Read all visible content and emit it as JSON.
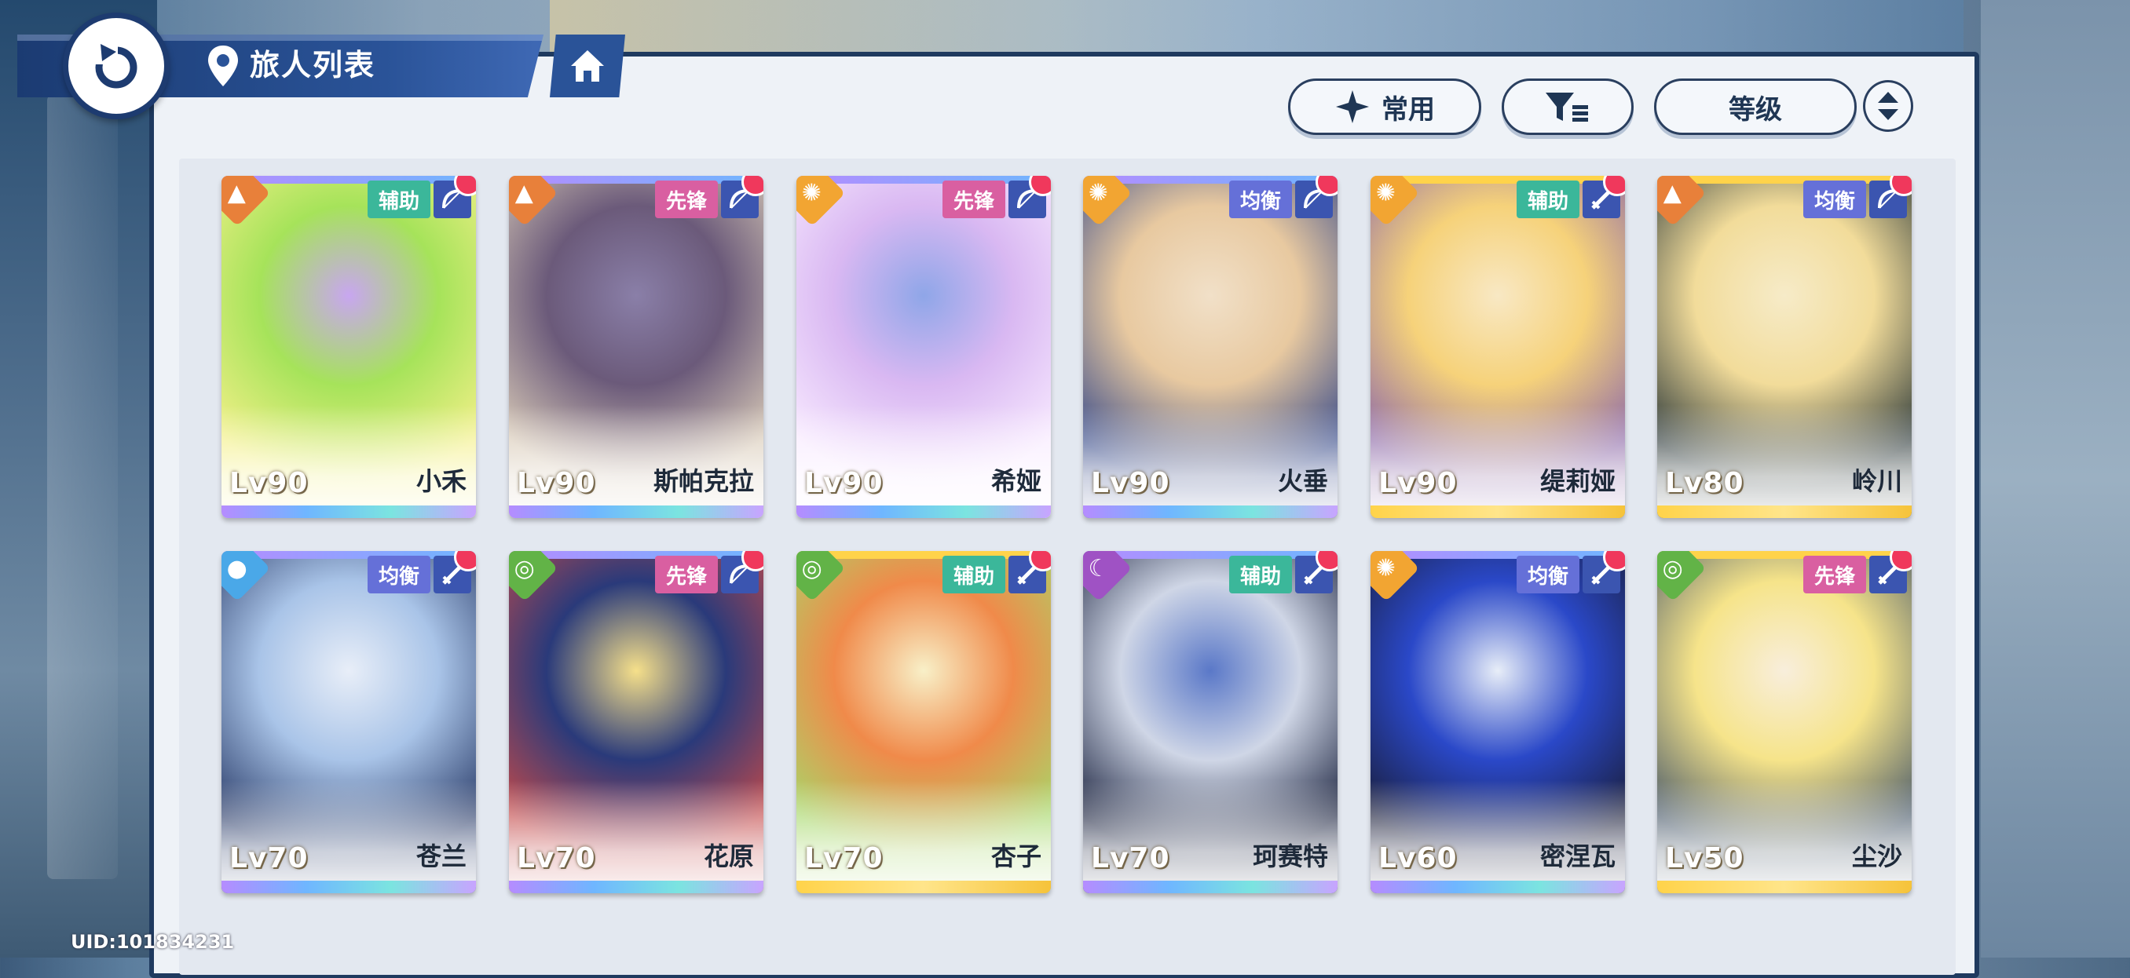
{
  "nav": {
    "title": "旅人列表",
    "back_icon": "back-arrow-icon",
    "home_icon": "home-icon",
    "location_icon": "location-pin-icon"
  },
  "controls": {
    "common_label": "常用",
    "filter_icon": "filter-icon",
    "sort_label": "等级",
    "sort_order_icon": "sort-updown-icon"
  },
  "colors": {
    "panel_border": "#1f3a5f",
    "accent_blue": "#2a5398",
    "notify_red": "#f0385c"
  },
  "characters": [
    {
      "name": "小禾",
      "level": "Lv90",
      "role": "辅助",
      "element": "earth",
      "weapon": "bow",
      "art": [
        "#a6e35a",
        "#f4f08a",
        "#c8a6f0"
      ],
      "strip": "rainbow"
    },
    {
      "name": "斯帕克拉",
      "level": "Lv90",
      "role": "先锋",
      "element": "earth",
      "weapon": "bow",
      "art": [
        "#6b5a7a",
        "#d9cbb8",
        "#8a7fa8"
      ],
      "strip": "rainbow"
    },
    {
      "name": "希娅",
      "level": "Lv90",
      "role": "先锋",
      "element": "sun",
      "weapon": "bow",
      "art": [
        "#d9b8f2",
        "#f8eaff",
        "#8fa6e8"
      ],
      "strip": "rainbow"
    },
    {
      "name": "火垂",
      "level": "Lv90",
      "role": "均衡",
      "element": "sun",
      "weapon": "bow",
      "art": [
        "#e8c9a0",
        "#3a4c8a",
        "#f1e0c8"
      ],
      "strip": "rainbow"
    },
    {
      "name": "缇莉娅",
      "level": "Lv90",
      "role": "辅助",
      "element": "sun",
      "weapon": "sword",
      "art": [
        "#f6d27a",
        "#8e6aa8",
        "#f8e8c4"
      ],
      "strip": "gold"
    },
    {
      "name": "岭川",
      "level": "Lv80",
      "role": "均衡",
      "element": "earth",
      "weapon": "bow",
      "art": [
        "#f2dc9a",
        "#2e3a3a",
        "#f6ebc8"
      ],
      "strip": "gold"
    },
    {
      "name": "苍兰",
      "level": "Lv70",
      "role": "均衡",
      "element": "water",
      "weapon": "sword",
      "art": [
        "#a9c4e8",
        "#2b3d6a",
        "#e8eef8"
      ],
      "strip": "rainbow"
    },
    {
      "name": "花原",
      "level": "Lv70",
      "role": "先锋",
      "element": "wind",
      "weapon": "bow",
      "art": [
        "#2a3a7a",
        "#c44a4a",
        "#f6e08a"
      ],
      "strip": "rainbow"
    },
    {
      "name": "杏子",
      "level": "Lv70",
      "role": "辅助",
      "element": "wind",
      "weapon": "sword",
      "art": [
        "#f08a4a",
        "#a6d86a",
        "#f8f0c8"
      ],
      "strip": "gold"
    },
    {
      "name": "珂赛特",
      "level": "Lv70",
      "role": "辅助",
      "element": "moon",
      "weapon": "sword",
      "art": [
        "#cfd6e6",
        "#1c2440",
        "#5a78c8"
      ],
      "strip": "rainbow"
    },
    {
      "name": "密涅瓦",
      "level": "Lv60",
      "role": "均衡",
      "element": "sun",
      "weapon": "sword",
      "art": [
        "#2a48c8",
        "#1a1e3a",
        "#e8eef8"
      ],
      "strip": "rainbow"
    },
    {
      "name": "尘沙",
      "level": "Lv50",
      "role": "先锋",
      "element": "wind",
      "weapon": "sword",
      "art": [
        "#f6e48a",
        "#4a5a6a",
        "#f8eedc"
      ],
      "strip": "gold"
    }
  ],
  "uid": "UID:101834231"
}
